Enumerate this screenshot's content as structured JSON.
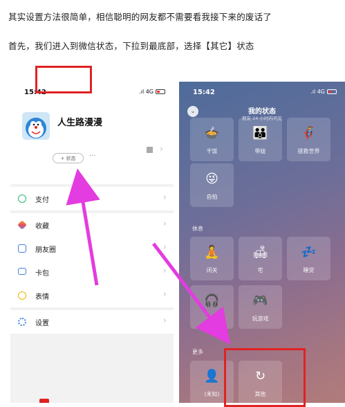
{
  "article": {
    "line1": "其实设置方法很简单，相信聪明的网友都不需要看我接下来的废话了",
    "line2": "首先，我们进入到微信状态，下拉到最底部，选择【其它】状态"
  },
  "left_phone": {
    "time": "15:42",
    "network": ".ıl 4G",
    "profile_name": "人生路漫漫",
    "status_button": "+ 状态",
    "more_dots": "···",
    "menu": [
      {
        "label": "支付",
        "icon": "pay-icon"
      },
      {
        "label": "收藏",
        "icon": "favorites-icon"
      },
      {
        "label": "朋友圈",
        "icon": "moments-icon"
      },
      {
        "label": "卡包",
        "icon": "cards-icon"
      },
      {
        "label": "表情",
        "icon": "sticker-icon"
      },
      {
        "label": "设置",
        "icon": "gear-icon"
      }
    ],
    "colors": {
      "highlight": "#e02222",
      "arrow": "#e33ce0"
    }
  },
  "right_phone": {
    "time": "15:42",
    "network": ".ıl 4G",
    "title": "我的状态",
    "subtitle": "朋友 24 小时内可见",
    "tiles_top": [
      {
        "label": "干饭",
        "icon": "bowl-icon"
      },
      {
        "label": "带娃",
        "icon": "parent-child-icon"
      },
      {
        "label": "拯救世界",
        "icon": "hero-icon"
      },
      {
        "label": "自拍",
        "icon": "selfie-icon"
      }
    ],
    "section_rest": "休息",
    "tiles_rest": [
      {
        "label": "闭关",
        "icon": "meditate-icon"
      },
      {
        "label": "宅",
        "icon": "lying-icon"
      },
      {
        "label": "睡觉",
        "icon": "sleep-icon"
      },
      {
        "label": "发呆",
        "icon": "daze-icon"
      },
      {
        "label": "玩游戏",
        "icon": "game-icon"
      }
    ],
    "section_more": "更多",
    "tiles_more": [
      {
        "label": "(未知)",
        "icon": "person-icon"
      },
      {
        "label": "其他",
        "icon": "refresh-icon"
      }
    ]
  }
}
